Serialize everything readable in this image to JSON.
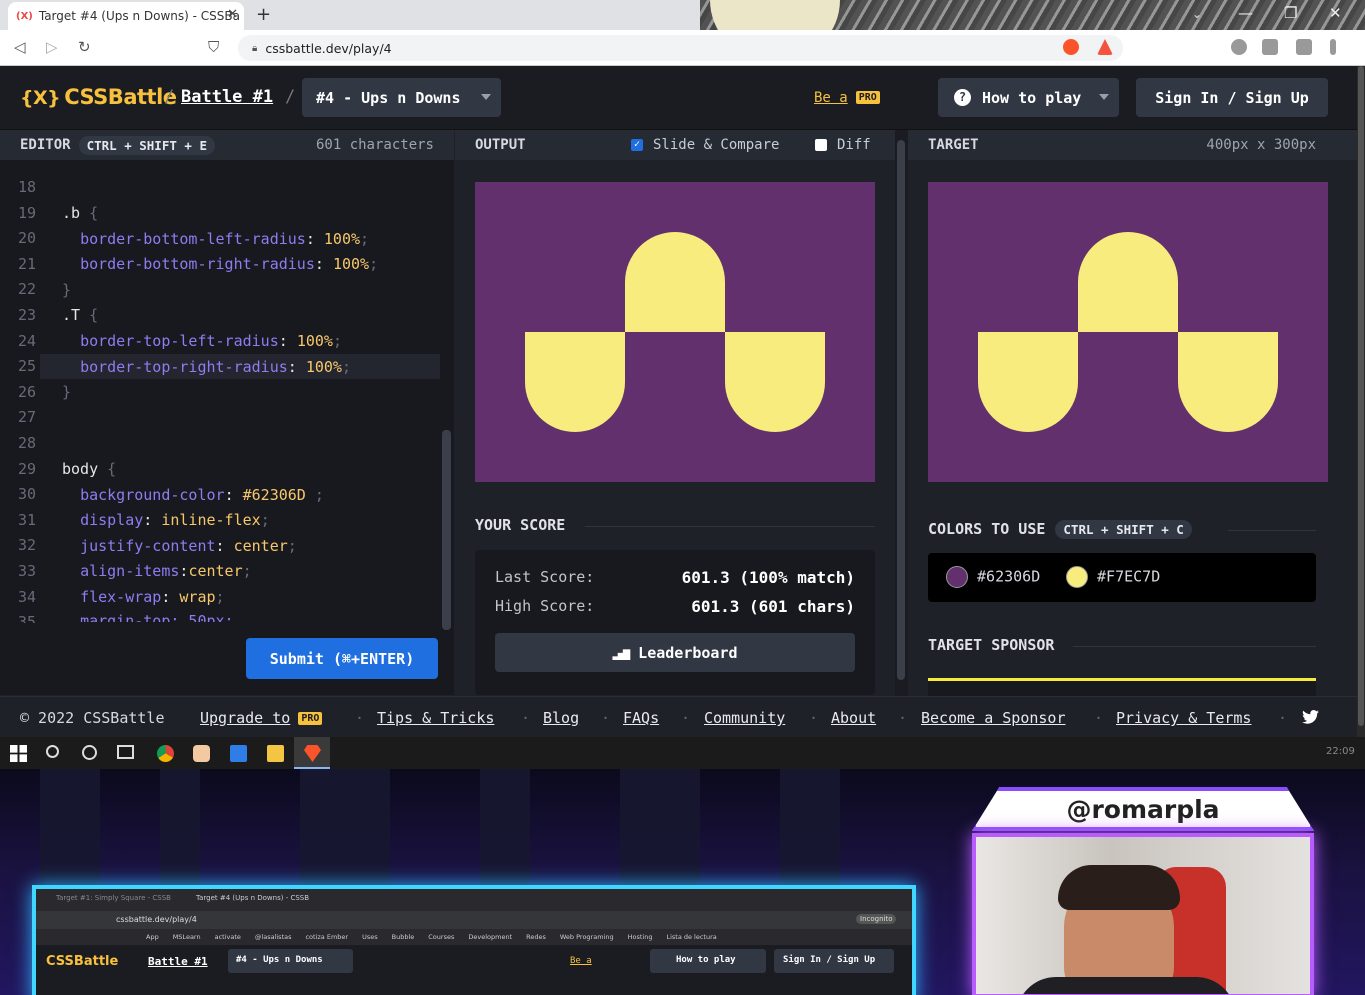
{
  "browser": {
    "tab_title": "Target #4 (Ups n Downs) - CSSBa",
    "tab_favicon": "(X)",
    "url": "cssbattle.dev/play/4"
  },
  "nav": {
    "logo_mark": "{X}",
    "logo_text": "CSSBattle",
    "sep": "/",
    "battle_link": "Battle #1",
    "target_select": "#4 - Ups n Downs",
    "be_a": "Be a",
    "pro_badge": "PRO",
    "how_to_play": "How to play",
    "help_icon": "?",
    "sign_in": "Sign In / Sign Up"
  },
  "editor": {
    "header_label": "EDITOR",
    "shortcut": "CTRL + SHIFT + E",
    "char_count": "601 characters",
    "line_numbers": [
      "18",
      "19",
      "20",
      "21",
      "22",
      "23",
      "24",
      "25",
      "26",
      "27",
      "28",
      "29",
      "30",
      "31",
      "32",
      "33",
      "34",
      "35"
    ],
    "code": {
      "l19_sel": ".b",
      "l20_prop": "border-bottom-left-radius",
      "l20_val": "100%",
      "l21_prop": "border-bottom-right-radius",
      "l21_val": "100%",
      "l23_sel": ".T",
      "l24_prop": "border-top-left-radius",
      "l24_val": "100%",
      "l25_prop": "border-top-right-radius",
      "l25_val": "100%",
      "l29_sel": "body",
      "l30_prop": "background-color",
      "l30_val": "#62306D",
      "l31_prop": "display",
      "l31_val": "inline-flex",
      "l32_prop": "justify-content",
      "l32_val": "center",
      "l33_prop": "align-items",
      "l33_val": "center",
      "l34_prop": "flex-wrap",
      "l34_val": "wrap",
      "l35_partial": "margin-top: 50px;"
    },
    "submit": "Submit (⌘+ENTER)"
  },
  "output": {
    "header_label": "OUTPUT",
    "slide_compare": "Slide & Compare",
    "slide_checked": true,
    "diff": "Diff",
    "diff_checked": false,
    "your_score": "YOUR SCORE",
    "last_score_label": "Last Score:",
    "last_score_value": "601.3 (100% match)",
    "high_score_label": "High Score:",
    "high_score_value": "601.3 (601 chars)",
    "leaderboard": "Leaderboard"
  },
  "target": {
    "header_label": "TARGET",
    "dims": "400px x 300px",
    "colors_title": "COLORS TO USE",
    "colors_shortcut": "CTRL + SHIFT + C",
    "colors": [
      {
        "hex": "#62306D"
      },
      {
        "hex": "#F7EC7D"
      }
    ],
    "sponsor_title": "TARGET SPONSOR"
  },
  "footer": {
    "copyright": "© 2022 CSSBattle",
    "upgrade": "Upgrade to",
    "links": [
      "Tips & Tricks",
      "Blog",
      "FAQs",
      "Community",
      "About",
      "Become a Sponsor",
      "Privacy & Terms"
    ],
    "twitter_icon": "twitter-icon"
  },
  "taskbar": {
    "clock": "22:09"
  },
  "stream": {
    "handle": "@romarpla",
    "mini": {
      "url": "cssbattle.dev/play/4",
      "tab1": "Target #1: Simply Square - CSSB",
      "tab2": "Target #4 (Ups n Downs) - CSSB",
      "bookmarks": [
        "App",
        "MSLearn",
        "activate",
        "@lasalistas",
        "cotiza Ember",
        "Uses",
        "Bubble",
        "Courses",
        "Development",
        "Redes",
        "Web Programing",
        "Hosting",
        "Lista de lectura"
      ],
      "incognito": "Incognito"
    }
  },
  "theme": {
    "purple": "#62306D",
    "yellow": "#F7EC7D",
    "accent": "#f7c13d",
    "submit_blue": "#1f6fe0"
  }
}
